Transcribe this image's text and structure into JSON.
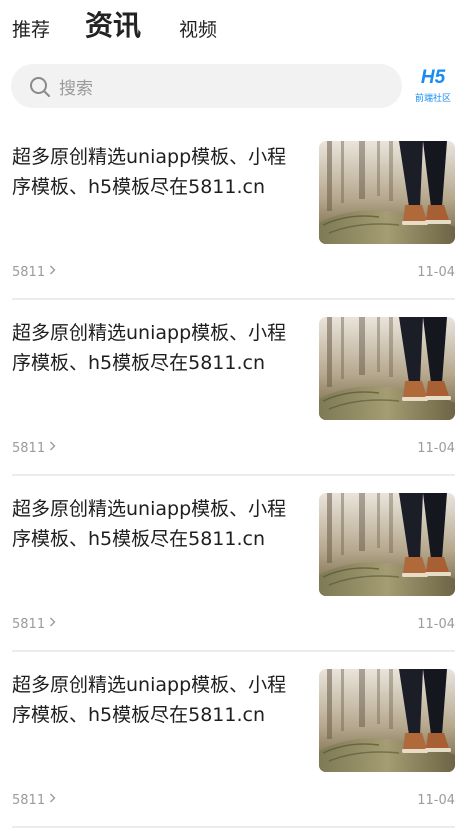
{
  "header": {
    "tabs": [
      {
        "label": "推荐",
        "active": false
      },
      {
        "label": "资讯",
        "active": true
      },
      {
        "label": "视频",
        "active": false
      }
    ],
    "accent_color": "#f5dc3a"
  },
  "search": {
    "placeholder": "搜索"
  },
  "brand": {
    "title": "H5",
    "subtitle": "前端社区",
    "color": "#1a8cf0"
  },
  "news": {
    "items": [
      {
        "title": "超多原创精选uniapp模板、小程序模板、h5模板尽在5811.cn",
        "source": "5811",
        "date": "11-04",
        "image_icon": "boots-on-log-photo"
      },
      {
        "title": "超多原创精选uniapp模板、小程序模板、h5模板尽在5811.cn",
        "source": "5811",
        "date": "11-04",
        "image_icon": "boots-on-log-photo"
      },
      {
        "title": "超多原创精选uniapp模板、小程序模板、h5模板尽在5811.cn",
        "source": "5811",
        "date": "11-04",
        "image_icon": "boots-on-log-photo"
      },
      {
        "title": "超多原创精选uniapp模板、小程序模板、h5模板尽在5811.cn",
        "source": "5811",
        "date": "11-04",
        "image_icon": "boots-on-log-photo"
      }
    ]
  }
}
